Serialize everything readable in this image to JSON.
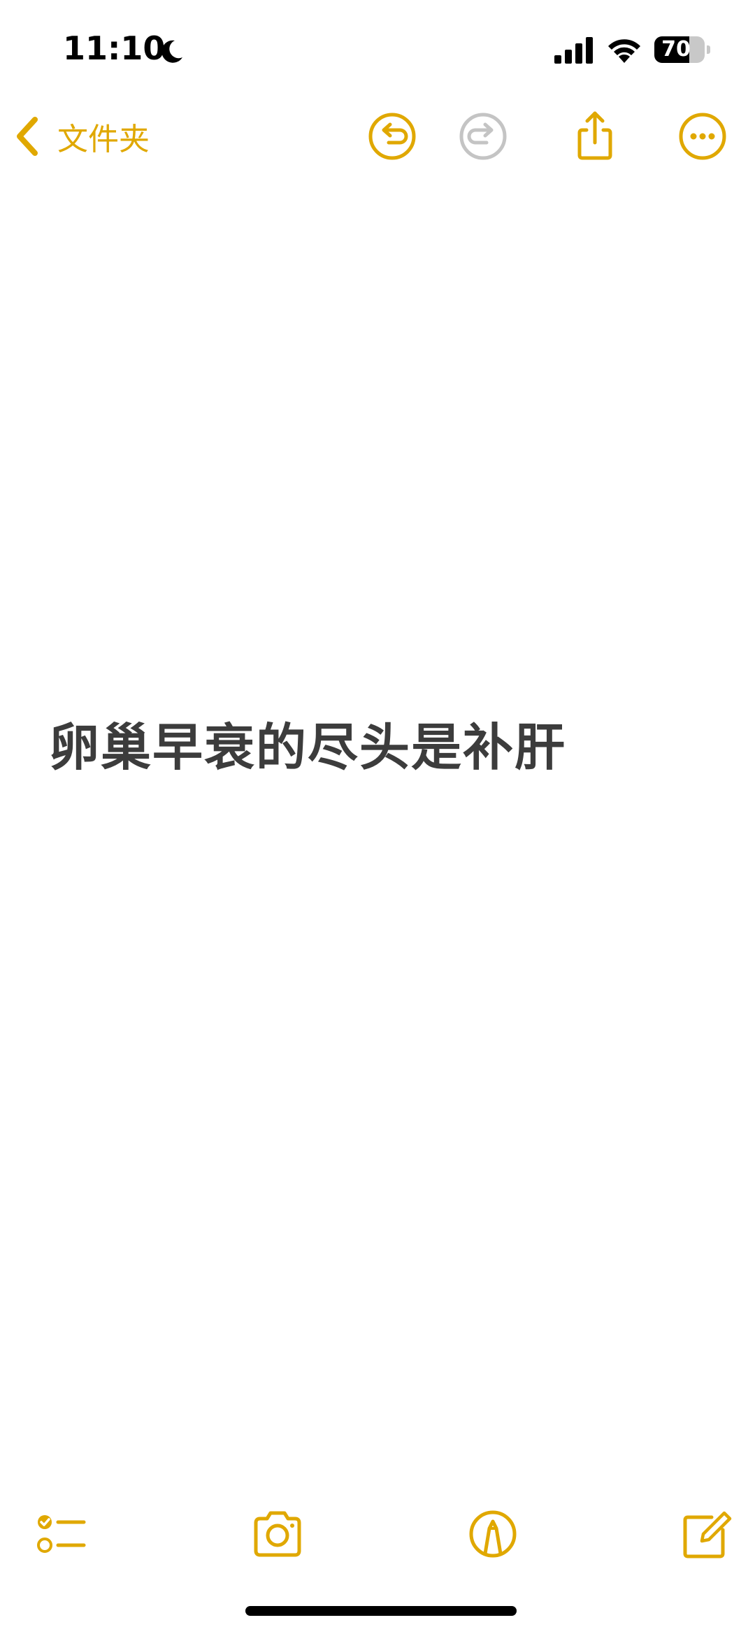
{
  "status_bar": {
    "time": "11:10",
    "battery_level": "70",
    "battery_fraction": 0.7
  },
  "nav": {
    "back_label": "文件夹",
    "icons": [
      "undo-icon",
      "redo-icon",
      "share-icon",
      "more-icon"
    ]
  },
  "note": {
    "title": "卵巢早衰的尽头是补肝"
  },
  "toolbar": {
    "icons": [
      "checklist-icon",
      "camera-icon",
      "markup-icon",
      "compose-icon"
    ]
  },
  "colors": {
    "accent": "#e0a800",
    "disabled": "#c4c4c4",
    "text": "#3c3c3c"
  }
}
